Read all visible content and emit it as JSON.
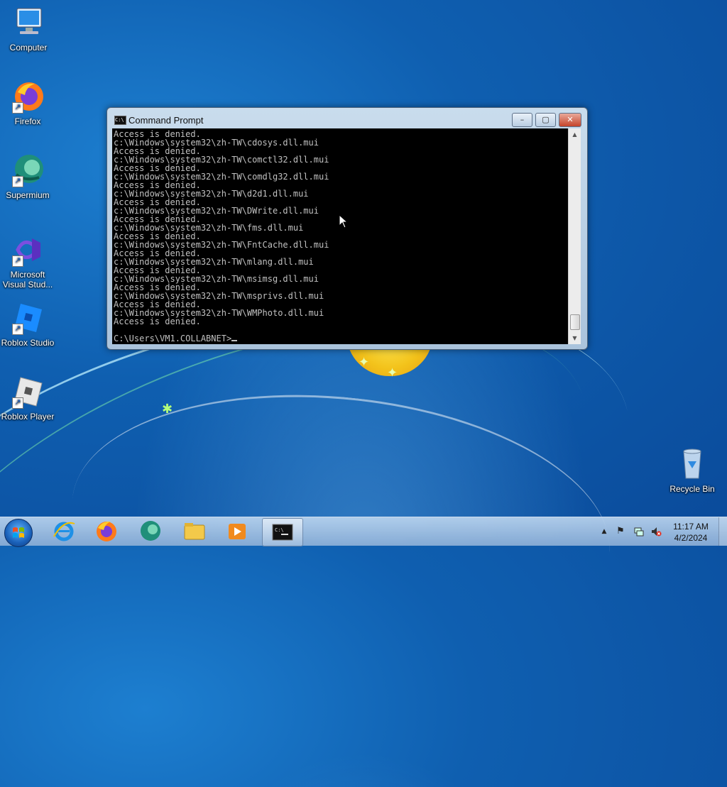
{
  "desktop": {
    "icons": [
      {
        "label": "Computer",
        "icon": "computer-icon"
      },
      {
        "label": "Firefox",
        "icon": "firefox-icon"
      },
      {
        "label": "Supermium",
        "icon": "supermium-icon"
      },
      {
        "label": "Microsoft Visual Stud...",
        "icon": "visual-studio-icon"
      },
      {
        "label": "Roblox Studio",
        "icon": "roblox-studio-icon"
      },
      {
        "label": "Roblox Player",
        "icon": "roblox-player-icon"
      },
      {
        "label": "Recycle Bin",
        "icon": "recycle-bin-icon"
      }
    ]
  },
  "window": {
    "title": "Command Prompt",
    "minimize": "–",
    "maximize": "▢",
    "close": "✕",
    "lines": [
      "Access is denied.",
      "c:\\Windows\\system32\\zh-TW\\cdosys.dll.mui",
      "Access is denied.",
      "c:\\Windows\\system32\\zh-TW\\comctl32.dll.mui",
      "Access is denied.",
      "c:\\Windows\\system32\\zh-TW\\comdlg32.dll.mui",
      "Access is denied.",
      "c:\\Windows\\system32\\zh-TW\\d2d1.dll.mui",
      "Access is denied.",
      "c:\\Windows\\system32\\zh-TW\\DWrite.dll.mui",
      "Access is denied.",
      "c:\\Windows\\system32\\zh-TW\\fms.dll.mui",
      "Access is denied.",
      "c:\\Windows\\system32\\zh-TW\\FntCache.dll.mui",
      "Access is denied.",
      "c:\\Windows\\system32\\zh-TW\\mlang.dll.mui",
      "Access is denied.",
      "c:\\Windows\\system32\\zh-TW\\msimsg.dll.mui",
      "Access is denied.",
      "c:\\Windows\\system32\\zh-TW\\msprivs.dll.mui",
      "Access is denied.",
      "c:\\Windows\\system32\\zh-TW\\WMPhoto.dll.mui",
      "Access is denied.",
      ""
    ],
    "prompt": "C:\\Users\\VM1.COLLABNET>"
  },
  "taskbar": {
    "items": [
      {
        "icon": "internet-explorer-icon",
        "active": false
      },
      {
        "icon": "firefox-icon",
        "active": false
      },
      {
        "icon": "supermium-icon",
        "active": false
      },
      {
        "icon": "file-explorer-icon",
        "active": false
      },
      {
        "icon": "media-player-icon",
        "active": false
      },
      {
        "icon": "command-prompt-icon",
        "active": true
      }
    ],
    "tray": {
      "time": "11:17 AM",
      "date": "4/2/2024",
      "icons": [
        "show-hidden-icons-icon",
        "action-center-flag-icon",
        "network-icon",
        "volume-muted-icon"
      ]
    }
  },
  "colors": {
    "console_bg": "#000000",
    "console_text": "#c0c0c0",
    "desktop_bg": "#0f5fb0"
  }
}
